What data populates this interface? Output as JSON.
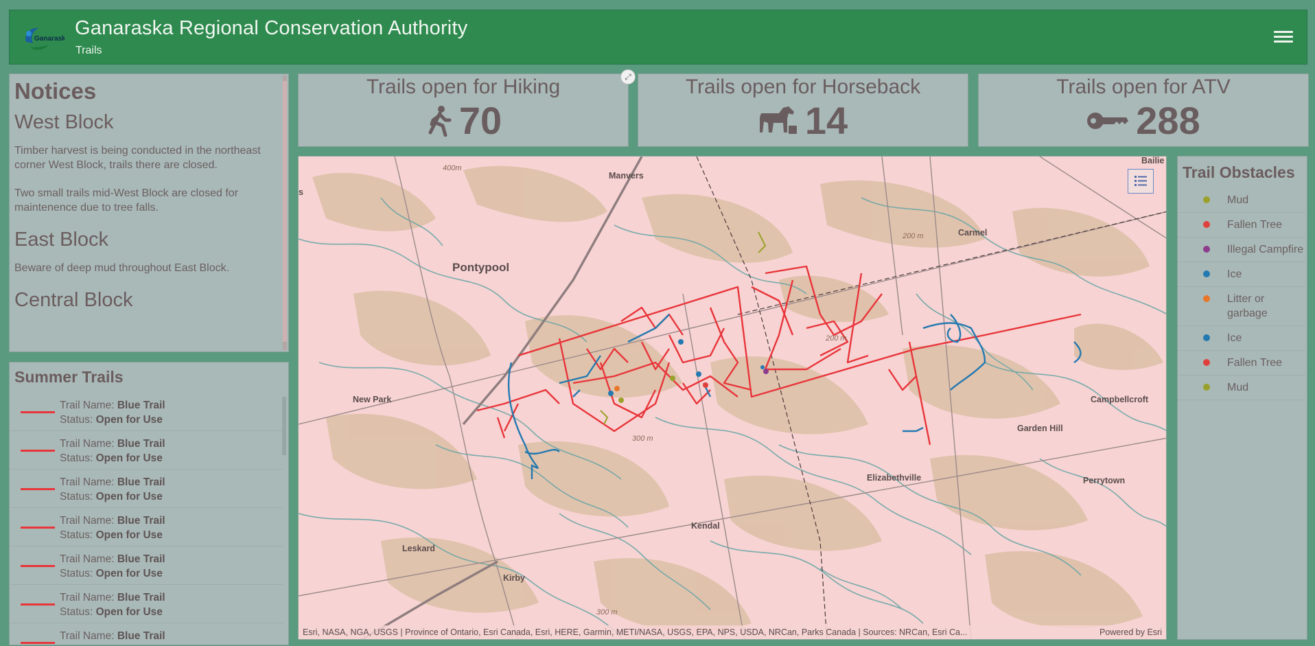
{
  "header": {
    "title": "Ganaraska Regional Conservation Authority",
    "subtitle": "Trails",
    "logo_text": "Ganaraska"
  },
  "notices": {
    "heading": "Notices",
    "sections": [
      {
        "title": "West Block",
        "paragraphs": [
          "Timber harvest is being conducted in the northeast corner West Block, trails there are closed.",
          "Two small trails mid-West Block are closed for maintenence due to tree falls."
        ]
      },
      {
        "title": "East Block",
        "paragraphs": [
          "Beware of deep mud throughout East Block."
        ]
      },
      {
        "title": "Central Block",
        "paragraphs": []
      }
    ]
  },
  "summer_trails": {
    "heading": "Summer Trails",
    "name_label": "Trail Name: ",
    "status_label": "Status: ",
    "color": "#e8353a",
    "items": [
      {
        "name": "Blue Trail",
        "status": "Open for Use"
      },
      {
        "name": "Blue Trail",
        "status": "Open for Use"
      },
      {
        "name": "Blue Trail",
        "status": "Open for Use"
      },
      {
        "name": "Blue Trail",
        "status": "Open for Use"
      },
      {
        "name": "Blue Trail",
        "status": "Open for Use"
      },
      {
        "name": "Blue Trail",
        "status": "Open for Use"
      },
      {
        "name": "Blue Trail",
        "status": ""
      }
    ]
  },
  "stats": {
    "hiking": {
      "title": "Trails open for Hiking",
      "value": "70",
      "icon": "hiker-icon"
    },
    "horseback": {
      "title": "Trails open for Horseback",
      "value": "14",
      "icon": "horse-icon"
    },
    "atv": {
      "title": "Trails open for ATV",
      "value": "288",
      "icon": "key-icon"
    }
  },
  "map": {
    "labels": {
      "manvers": "Manvers",
      "pontypool": "Pontypool",
      "carmel": "Carmel",
      "new_park": "New Park",
      "campbellcroft": "Campbellcroft",
      "garden_hill": "Garden Hill",
      "elizabethville": "Elizabethville",
      "perrytown": "Perrytown",
      "kendal": "Kendal",
      "leskard": "Leskard",
      "kirby": "Kirby",
      "baillie": "Bailie",
      "s": "s",
      "c400": "400m",
      "c200": "200 m",
      "c300": "300 m",
      "c300b": "300 m",
      "c200b": "200 m"
    },
    "attribution": "Esri, NASA, NGA, USGS | Province of Ontario, Esri Canada, Esri, HERE, Garmin, METI/NASA, USGS, EPA, NPS, USDA, NRCan, Parks Canada | Sources: NRCan, Esri Ca...",
    "powered_by": "Powered by Esri"
  },
  "obstacles": {
    "heading": "Trail Obstacles",
    "items": [
      {
        "label": "Mud",
        "color": "#9aa12b"
      },
      {
        "label": "Fallen Tree",
        "color": "#e0403c"
      },
      {
        "label": "Illegal Campfire",
        "color": "#8e3d8c"
      },
      {
        "label": "Ice",
        "color": "#2479b0"
      },
      {
        "label": "Litter or garbage",
        "color": "#e8772a"
      },
      {
        "label": "Ice",
        "color": "#2479b0"
      },
      {
        "label": "Fallen Tree",
        "color": "#e0403c"
      },
      {
        "label": "Mud",
        "color": "#9aa12b"
      }
    ]
  }
}
